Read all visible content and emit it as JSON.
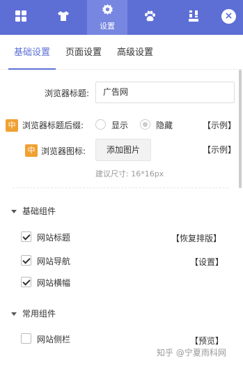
{
  "top_tabs": [
    {
      "icon": "grid-icon",
      "label": ""
    },
    {
      "icon": "shirt-icon",
      "label": ""
    },
    {
      "icon": "gear-icon",
      "label": "设置"
    },
    {
      "icon": "paw-icon",
      "label": ""
    },
    {
      "icon": "layout-icon",
      "label": ""
    }
  ],
  "close_label": "×",
  "sub_tabs": [
    "基础设置",
    "页面设置",
    "高级设置"
  ],
  "browser_title": {
    "label": "浏览器标题:",
    "value": "广告网"
  },
  "title_suffix": {
    "badge": "中",
    "label": "浏览器标题后缀:",
    "options": [
      "显示",
      "隐藏"
    ],
    "selected": "隐藏",
    "example": "【示例】"
  },
  "browser_icon": {
    "badge": "中",
    "label": "浏览器图标:",
    "button": "添加图片",
    "example": "【示例】",
    "hint": "建议尺寸: 16*16px"
  },
  "basic_components": {
    "title": "基础组件",
    "items": [
      {
        "label": "网站标题",
        "checked": true,
        "action": "【恢复排版】"
      },
      {
        "label": "网站导航",
        "checked": true,
        "action": "【设置】"
      },
      {
        "label": "网站横幅",
        "checked": true,
        "action": ""
      }
    ]
  },
  "common_components": {
    "title": "常用组件",
    "items": [
      {
        "label": "网站侧栏",
        "checked": false,
        "action": "【预览】"
      }
    ]
  },
  "watermark": "知乎 @宁夏雨科网"
}
